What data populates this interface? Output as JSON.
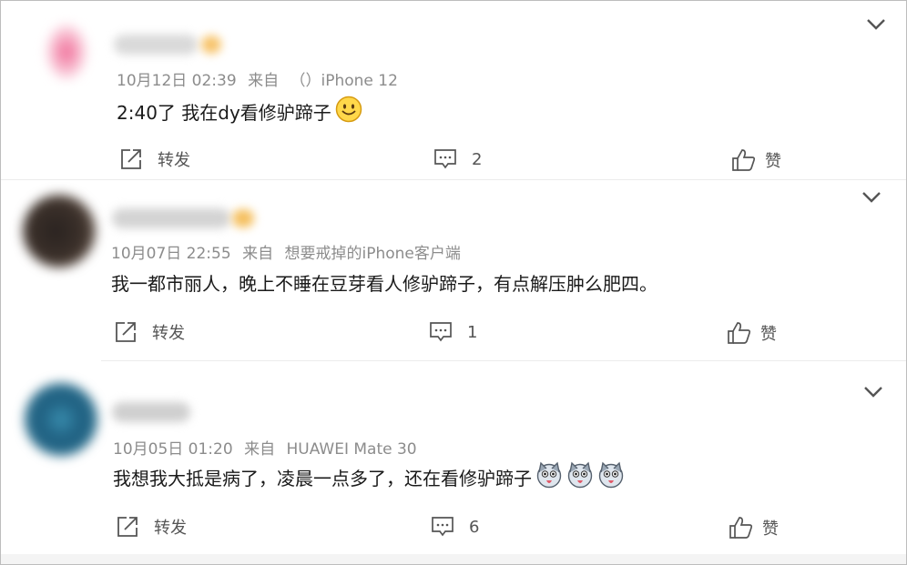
{
  "colors": {
    "meta": "#8c8c8c",
    "text": "#1a1a1a",
    "action": "#555555",
    "divider": "#ececec"
  },
  "comments": [
    {
      "time": "10月12日 02:39",
      "source_prefix": "来自",
      "source": "（）iPhone 12",
      "text": "2:40了 我在dy看修驴蹄子",
      "emojis": [
        "smile-emoji"
      ],
      "repost_label": "转发",
      "reply_count": "2",
      "like_label": "赞"
    },
    {
      "time": "10月07日 22:55",
      "source_prefix": "来自",
      "source": "想要戒掉的iPhone客户端",
      "text": "我一都市丽人，晚上不睡在豆芽看人修驴蹄子，有点解压肿么肥四。",
      "emojis": [],
      "repost_label": "转发",
      "reply_count": "1",
      "like_label": "赞"
    },
    {
      "time": "10月05日 01:20",
      "source_prefix": "来自",
      "source": "HUAWEI Mate 30",
      "text": "我想我大抵是病了，凌晨一点多了，还在看修驴蹄子",
      "emojis": [
        "husky-emoji",
        "husky-emoji",
        "husky-emoji"
      ],
      "repost_label": "转发",
      "reply_count": "6",
      "like_label": "赞"
    }
  ]
}
